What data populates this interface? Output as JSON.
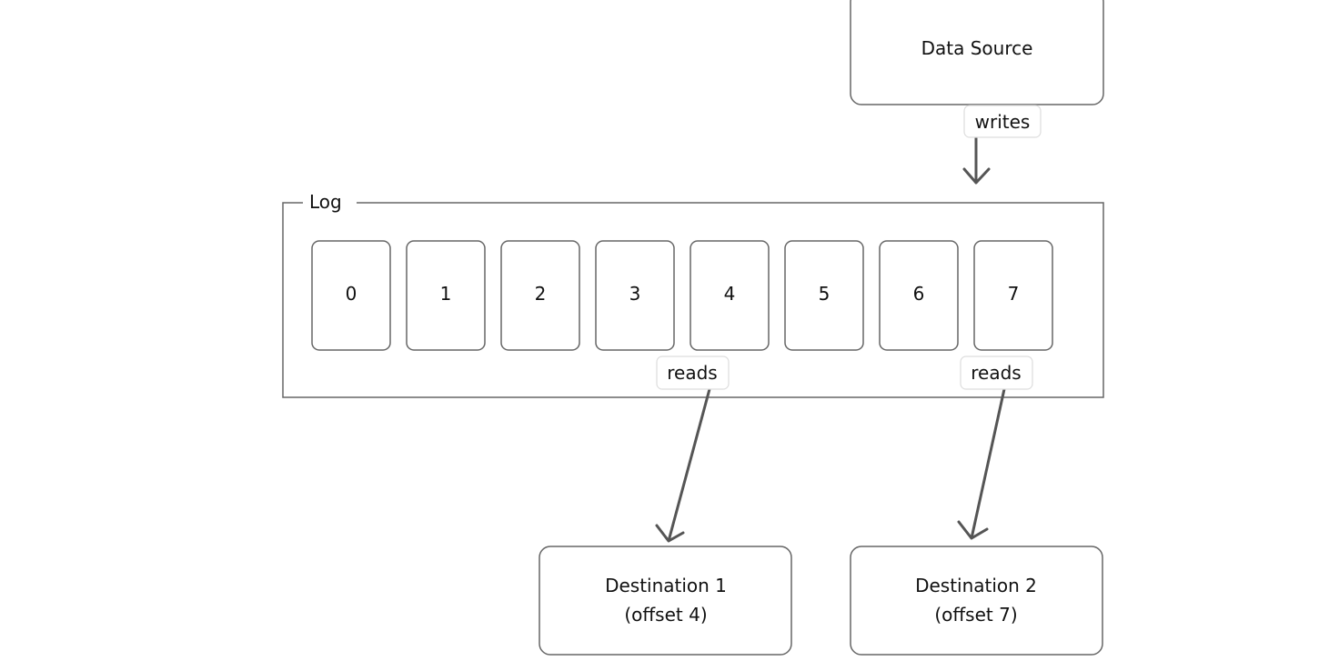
{
  "data_source": {
    "label": "Data Source"
  },
  "writes_label": "writes",
  "log": {
    "label": "Log",
    "cells": [
      "0",
      "1",
      "2",
      "3",
      "4",
      "5",
      "6",
      "7"
    ]
  },
  "reads_labels": [
    "reads",
    "reads"
  ],
  "destinations": [
    {
      "line1": "Destination 1",
      "line2": "(offset 4)"
    },
    {
      "line1": "Destination 2",
      "line2": "(offset 7)"
    }
  ]
}
